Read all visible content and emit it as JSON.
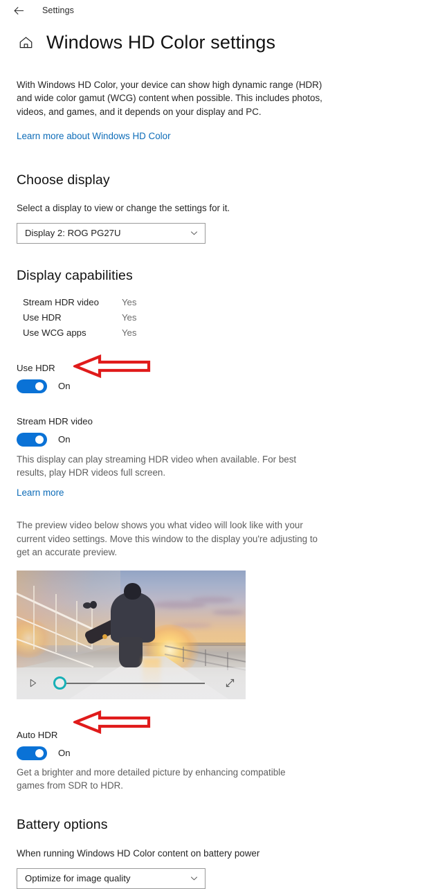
{
  "titlebar": {
    "back_icon": "back-arrow-icon",
    "label": "Settings"
  },
  "header": {
    "home_icon": "home-icon",
    "title": "Windows HD Color settings"
  },
  "intro": {
    "description": "With Windows HD Color, your device can show high dynamic range (HDR) and wide color gamut (WCG) content when possible. This includes photos, videos, and games, and it depends on your display and PC.",
    "learn_more_link": "Learn more about Windows HD Color"
  },
  "choose_display": {
    "heading": "Choose display",
    "subtext": "Select a display to view or change the settings for it.",
    "selected": "Display 2: ROG PG27U",
    "chevron_icon": "chevron-down-icon"
  },
  "display_capabilities": {
    "heading": "Display capabilities",
    "rows": [
      {
        "label": "Stream HDR video",
        "value": "Yes"
      },
      {
        "label": "Use HDR",
        "value": "Yes"
      },
      {
        "label": "Use WCG apps",
        "value": "Yes"
      }
    ]
  },
  "use_hdr": {
    "label": "Use HDR",
    "state": "On",
    "annotation_icon": "red-left-arrow-annotation"
  },
  "stream_hdr_video": {
    "label": "Stream HDR video",
    "state": "On",
    "description": "This display can play streaming HDR video when available. For best results, play HDR videos full screen.",
    "learn_more_link": "Learn more"
  },
  "preview": {
    "description": "The preview video below shows you what video will look like with your current video settings. Move this window to the display you're adjusting to get an accurate preview.",
    "image_alt": "Person walking along a pier at sunset carrying a skateboard",
    "controls": {
      "play_icon": "play-icon",
      "scrubber": "video-scrubber",
      "fullscreen_icon": "fullscreen-expand-icon"
    }
  },
  "auto_hdr": {
    "label": "Auto HDR",
    "state": "On",
    "description": "Get a brighter and more detailed picture by enhancing compatible games from SDR to HDR.",
    "annotation_icon": "red-left-arrow-annotation"
  },
  "battery_options": {
    "heading": "Battery options",
    "subtext": "When running Windows HD Color content on battery power",
    "selected": "Optimize for image quality",
    "chevron_icon": "chevron-down-icon"
  },
  "colors": {
    "accent": "#0a72d6",
    "link": "#0d6cb8",
    "annotation_red": "#e01b1b",
    "scrubber_teal": "#17b0b6"
  }
}
